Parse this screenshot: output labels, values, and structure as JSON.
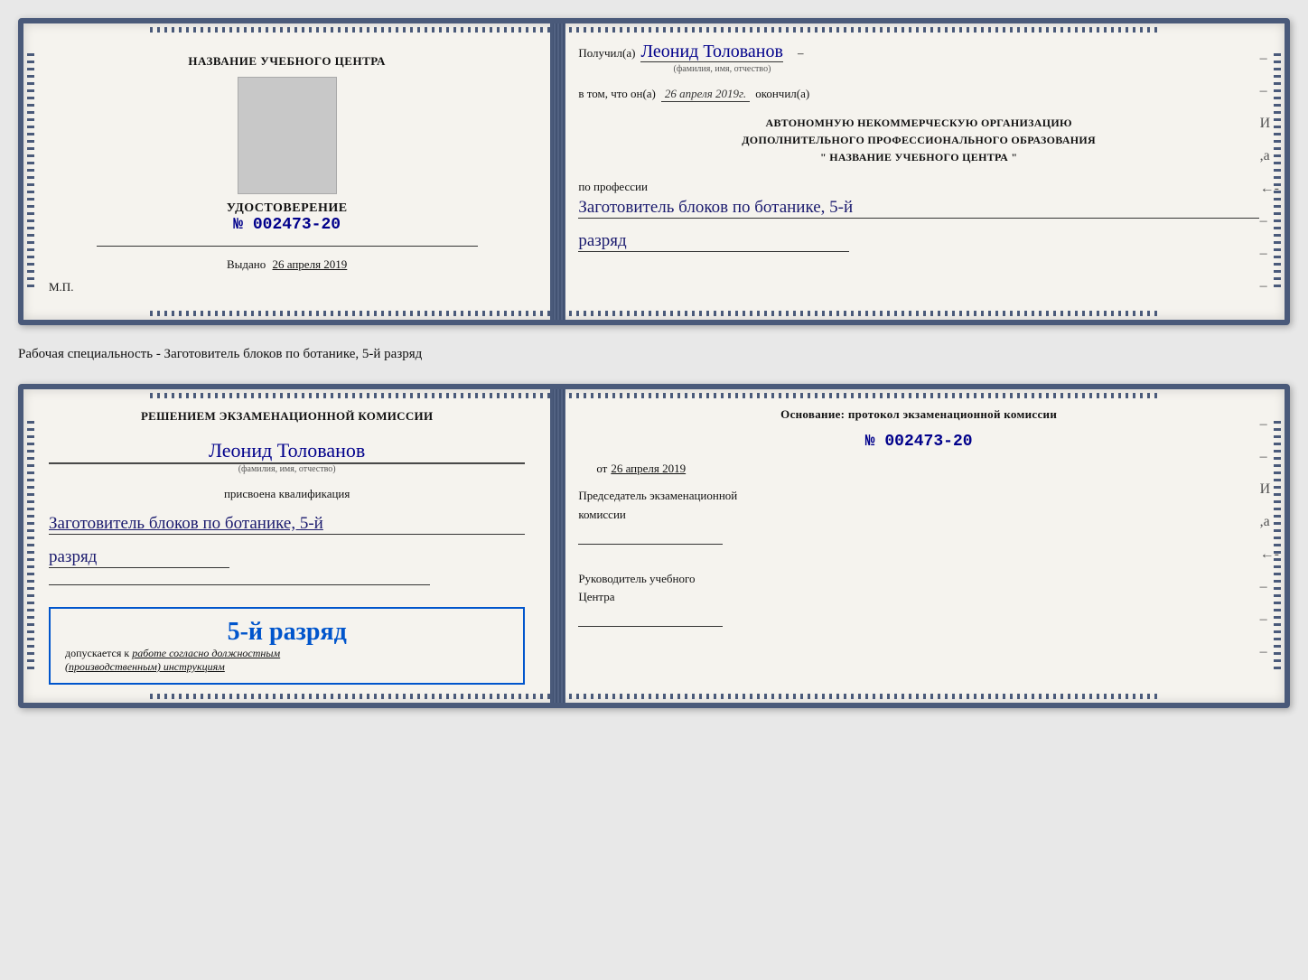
{
  "doc1": {
    "left": {
      "center_name": "НАЗВАНИЕ УЧЕБНОГО ЦЕНТРА",
      "udostoverenie_title": "УДОСТОВЕРЕНИЕ",
      "number_prefix": "№",
      "number": "002473-20",
      "vydano_label": "Выдано",
      "vydano_date": "26 апреля 2019",
      "mp_label": "М.П."
    },
    "right": {
      "recipient_label": "Получил(а)",
      "recipient_name": "Леонид Толованов",
      "fio_hint": "(фамилия, имя, отчество)",
      "vtom_label": "в том, что он(а)",
      "vtom_date": "26 апреля 2019г.",
      "okonchil": "окончил(а)",
      "org_line1": "АВТОНОМНУЮ НЕКОММЕРЧЕСКУЮ ОРГАНИЗАЦИЮ",
      "org_line2": "ДОПОЛНИТЕЛЬНОГО ПРОФЕССИОНАЛЬНОГО ОБРАЗОВАНИЯ",
      "org_name_prefix": "\"",
      "org_name": "НАЗВАНИЕ УЧЕБНОГО ЦЕНТРА",
      "org_name_suffix": "\"",
      "prof_label": "по профессии",
      "prof_name": "Заготовитель блоков по ботанике, 5-й",
      "razryad": "разряд"
    }
  },
  "specialty_label": "Рабочая специальность - Заготовитель блоков по ботанике, 5-й разряд",
  "doc2": {
    "left": {
      "resheniem_label": "Решением экзаменационной комиссии",
      "name": "Леонид Толованов",
      "fio_hint": "(фамилия, имя, отчество)",
      "prisvoena_label": "присвоена квалификация",
      "kvalif_name": "Заготовитель блоков по ботанике, 5-й",
      "razryad": "разряд",
      "stamp_razryad": "5-й разряд",
      "dopusk_prefix": "допускается к",
      "dopusk_italic": "работе согласно должностным",
      "dopusk_italic2": "(производственным) инструкциям"
    },
    "right": {
      "osnovanie_label": "Основание: протокол экзаменационной комиссии",
      "number_prefix": "№",
      "number": "002473-20",
      "ot_label": "от",
      "ot_date": "26 апреля 2019",
      "predsedatel_line1": "Председатель экзаменационной",
      "predsedatel_line2": "комиссии",
      "rukovoditel_line1": "Руководитель учебного",
      "rukovoditel_line2": "Центра"
    }
  }
}
